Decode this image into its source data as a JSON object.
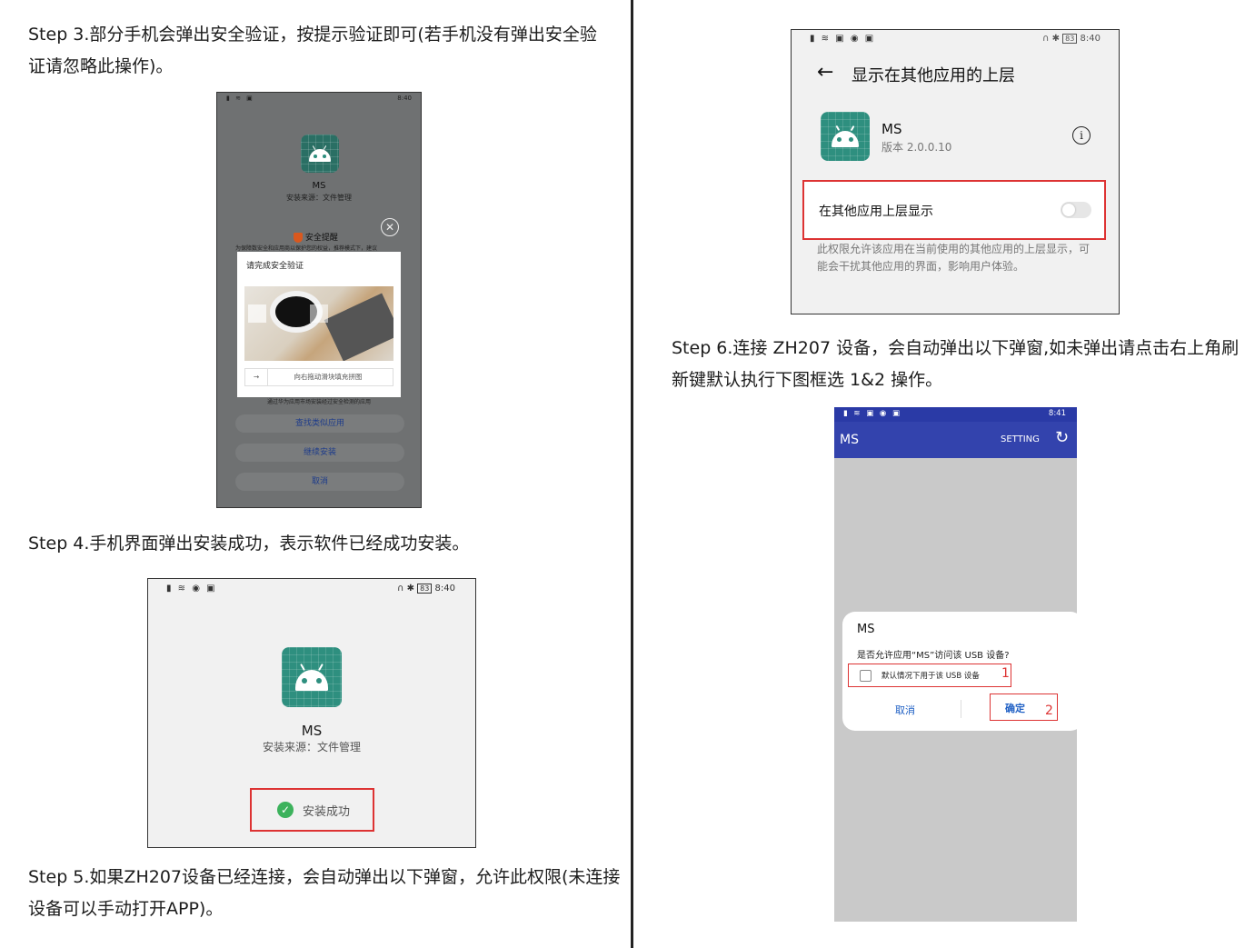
{
  "steps": {
    "step3_line1": "Step 3.部分手机会弹出安全验证，按提示验证即可(若手机没有弹出安全验",
    "step3_line2": "证请忽略此操作)。",
    "step4": "Step 4.手机界面弹出安装成功，表示软件已经成功安装。",
    "step5_line1": "Step 5.如果ZH207设备已经连接，会自动弹出以下弹窗，允许此权限(未连接",
    "step5_line2": "设备可以手动打开APP)。",
    "step6_line1": "Step 6.连接 ZH207 设备，会自动弹出以下弹窗,如未弹出请点击右上角刷",
    "step6_line2": "新键默认执行下图框选 1&2 操作。"
  },
  "shot1": {
    "status_time": "8:40",
    "app_name": "MS",
    "install_source": "安装来源：文件管理",
    "security_title": "安全提醒",
    "security_text": "为保障数安全和应用商以保护您的权益，推荐模式下，建议",
    "verify_title": "请完成安全验证",
    "slider_text": "向右拖动滑块填充拼图",
    "verified_note": "通过华为应用市场安装经过安全检测的应用",
    "btn_find": "查找类似应用",
    "btn_continue": "继续安装",
    "btn_cancel": "取消"
  },
  "shot2": {
    "status_time": "8:40",
    "battery": "83",
    "app_name": "MS",
    "install_source": "安装来源：文件管理",
    "success_label": "安装成功"
  },
  "shot3": {
    "status_time": "8:40",
    "battery": "83",
    "header": "显示在其他应用的上层",
    "app_name": "MS",
    "version": "版本 2.0.0.10",
    "toggle_label": "在其他应用上层显示",
    "description": "此权限允许该应用在当前使用的其他应用的上层显示，可能会干扰其他应用的界面，影响用户体验。"
  },
  "shot4": {
    "status_time": "8:41",
    "app_title": "MS",
    "setting": "SETTING",
    "dialog_title": "MS",
    "dialog_question": "是否允许应用“MS”访问该 USB 设备?",
    "checkbox_label": "默认情况下用于该 USB 设备",
    "marker1": "1",
    "cancel": "取消",
    "ok": "确定",
    "marker2": "2"
  },
  "colors": {
    "accent_red": "#d33333",
    "app_bar": "#3343ad",
    "android_teal": "#2e8f7f",
    "success_green": "#3cb25c"
  }
}
